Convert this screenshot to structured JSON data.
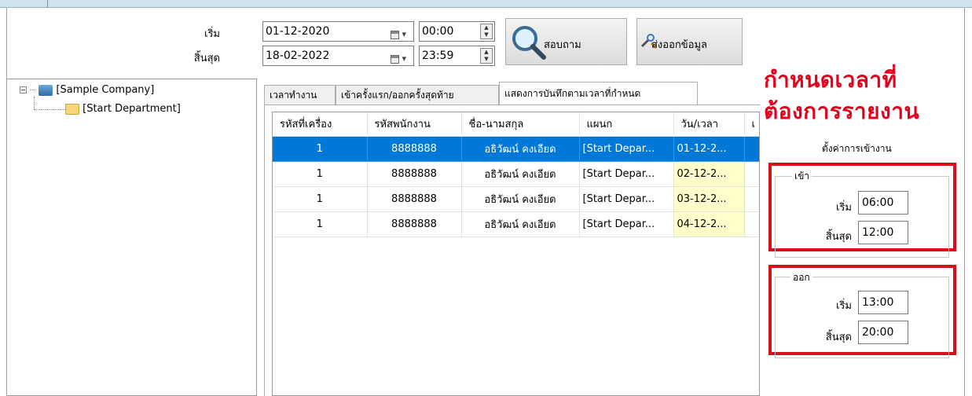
{
  "filter": {
    "start_label": "เริ่ม",
    "end_label": "สิ้นสุด",
    "start_date": "01-12-2020",
    "end_date": "18-02-2022",
    "start_time": "00:00",
    "end_time": "23:59",
    "query_button": "สอบถาม",
    "export_button": "ส่งออกข้อมูล"
  },
  "tree": {
    "root": "[Sample Company]",
    "child": "[Start Department]"
  },
  "tabs": [
    {
      "label": "เวลาทำงาน"
    },
    {
      "label": "เข้าครั้งแรก/ออกครั้งสุดท้าย"
    },
    {
      "label": "แสดงการบันทึกตามเวลาที่กำหนด"
    }
  ],
  "grid": {
    "columns": [
      "รหัสที่เครื่อง",
      "รหัสพนักงาน",
      "ชื่อ-นามสกุล",
      "แผนก",
      "วัน/เวลา",
      "เ"
    ],
    "rows": [
      {
        "device": "1",
        "emp": "8888888",
        "name": "อธิวัฒน์ คงเอียด",
        "dept": "[Start Depar...",
        "datetime": "01-12-2..."
      },
      {
        "device": "1",
        "emp": "8888888",
        "name": "อธิวัฒน์ คงเอียด",
        "dept": "[Start Depar...",
        "datetime": "02-12-2..."
      },
      {
        "device": "1",
        "emp": "8888888",
        "name": "อธิวัฒน์ คงเอียด",
        "dept": "[Start Depar...",
        "datetime": "03-12-2..."
      },
      {
        "device": "1",
        "emp": "8888888",
        "name": "อธิวัฒน์ คงเอียด",
        "dept": "[Start Depar...",
        "datetime": "04-12-2..."
      }
    ]
  },
  "annotation": {
    "line1": "กำหนดเวลาที่",
    "line2": "ต้องการรายงาน",
    "color": "#e4001b"
  },
  "settings": {
    "title": "ตั้งค่าการเข้างาน",
    "in_group": {
      "title": "เข้า",
      "start_label": "เริ่ม",
      "start": "06:00",
      "end_label": "สิ้นสุด",
      "end": "12:00"
    },
    "out_group": {
      "title": "ออก",
      "start_label": "เริ่ม",
      "start": "13:00",
      "end_label": "สิ้นสุด",
      "end": "20:00"
    }
  },
  "colors": {
    "selection": "#0078d7",
    "highlight_cell": "#ffffcc",
    "annotation_box": "#d7101c"
  },
  "icons": {
    "query": "magnifier-icon",
    "export": "export-tool-icon",
    "company": "computer-network-icon",
    "department": "folder-open-icon"
  }
}
